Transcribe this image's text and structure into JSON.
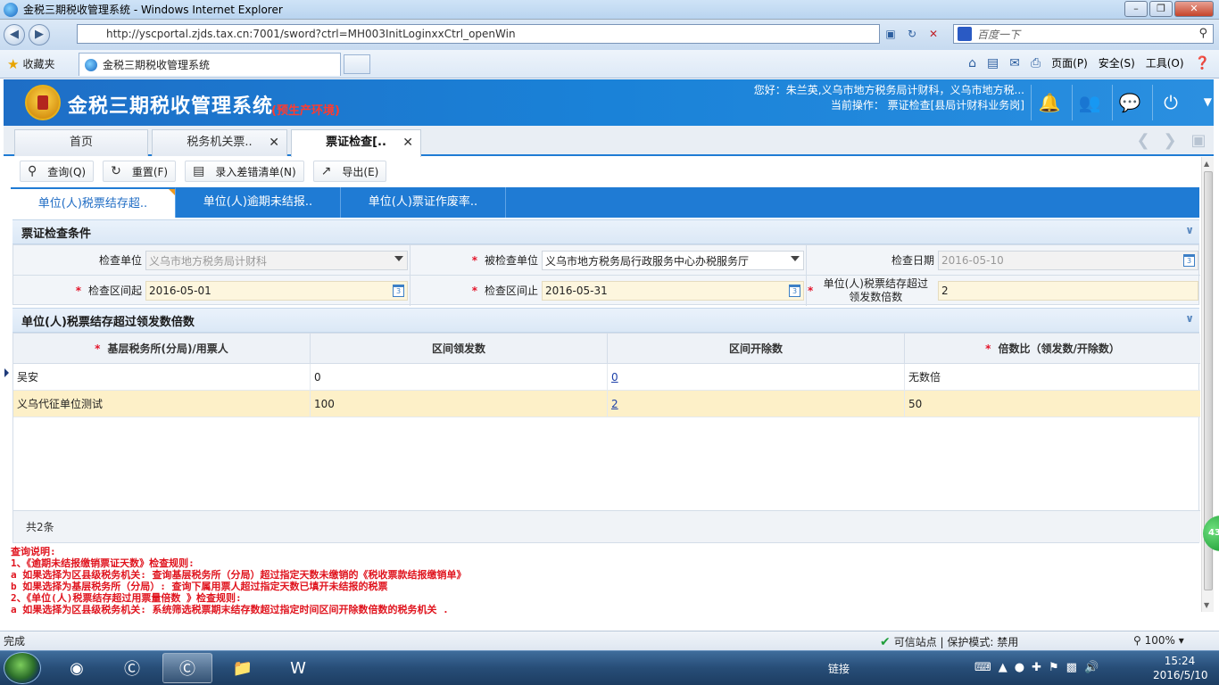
{
  "browser": {
    "window_title": "金税三期税收管理系统 - Windows Internet Explorer",
    "url": "http://yscportal.zjds.tax.cn:7001/sword?ctrl=MH003InitLoginxxCtrl_openWin",
    "search_placeholder": "百度一下",
    "favorites_label": "收藏夹",
    "tab_title": "金税三期税收管理系统",
    "menu_page": "页面(P)",
    "menu_safety": "安全(S)",
    "menu_tools": "工具(O)",
    "status_left": "完成",
    "status_zone": "可信站点 | 保护模式: 禁用",
    "status_zoom": "100%"
  },
  "app": {
    "name": "金税三期税收管理系统",
    "env_tag": "(预生产环境)",
    "greeting": "您好：朱兰英,义乌市地方税务局计财科，义乌市地方税...",
    "current_op": "当前操作： 票证检查[县局计财科业务岗]",
    "tabs": [
      {
        "label": "首页"
      },
      {
        "label": "税务机关票.."
      },
      {
        "label": "票证检查[.."
      }
    ]
  },
  "toolbar": {
    "query": "查询(Q)",
    "reset": "重置(F)",
    "enter_list": "录入差错清单(N)",
    "export": "导出(E)"
  },
  "subtabs": [
    {
      "label": "单位(人)税票结存超.."
    },
    {
      "label": "单位(人)逾期未结报.."
    },
    {
      "label": "单位(人)票证作废率.."
    }
  ],
  "conditions": {
    "title": "票证检查条件",
    "check_unit_label": "检查单位",
    "check_unit_value": "义乌市地方税务局计财科",
    "checked_unit_label": "被检查单位",
    "checked_unit_value": "义乌市地方税务局行政服务中心办税服务厅",
    "check_date_label": "检查日期",
    "check_date_value": "2016-05-10",
    "range_start_label": "检查区间起",
    "range_start_value": "2016-05-01",
    "range_end_label": "检查区间止",
    "range_end_value": "2016-05-31",
    "multiple_label": "单位(人)税票结存超过领发数倍数",
    "multiple_value": "2"
  },
  "result": {
    "title": "单位(人)税票结存超过领发数倍数",
    "columns": [
      "基层税务所(分局)/用票人",
      "区间领发数",
      "区间开除数",
      "倍数比（领发数/开除数）"
    ],
    "rows": [
      {
        "c1": "吴安",
        "c2": "0",
        "c3": "0",
        "c4": "无数倍"
      },
      {
        "c1": "义乌代征单位测试",
        "c2": "100",
        "c3": "2",
        "c4": "50"
      }
    ],
    "footer": "共2条"
  },
  "notes": {
    "line1": "查询说明:",
    "line2": "1、《逾期未结报缴销票证天数》检查规则:",
    "line3": "a 如果选择为区县级税务机关: 查询基层税务所（分局）超过指定天数未缴销的《税收票款结报缴销单》",
    "line4": "b 如果选择为基层税务所（分局）: 查询下属用票人超过指定天数已填开未结报的税票",
    "line5": "2、《单位(人)税票结存超过用票量倍数 》检查规则:",
    "line6": "a 如果选择为区县级税务机关: 系统筛选税票期末结存数超过指定时间区间开除数倍数的税务机关 ."
  },
  "taskbar": {
    "tray_link": "链接",
    "time": "15:24",
    "date": "2016/5/10"
  },
  "badge": "43",
  "colors": {
    "header_blue": "#1f7bd4",
    "required_red": "#e4152b",
    "highlight_row": "#fdf0c8",
    "note_red": "#e0141e"
  }
}
